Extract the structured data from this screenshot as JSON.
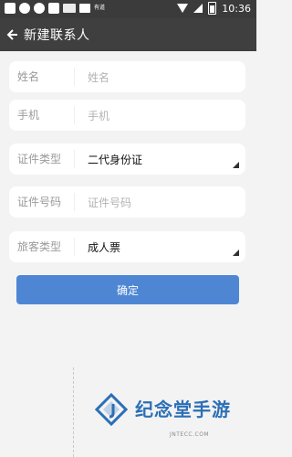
{
  "status_bar": {
    "time": "10:36",
    "left_icons": [
      "square-icon",
      "circle-icon",
      "circle-icon",
      "square-icon",
      "keyboard-icon",
      "image-icon",
      "text-icon"
    ],
    "text_icon_label": "有道"
  },
  "header": {
    "title": "新建联系人"
  },
  "form": {
    "rows": [
      {
        "label": "姓名",
        "value": "姓名",
        "type": "input"
      },
      {
        "label": "手机",
        "value": "手机",
        "type": "input"
      },
      {
        "label": "证件类型",
        "value": "二代身份证",
        "type": "select"
      },
      {
        "label": "证件号码",
        "value": "证件号码",
        "type": "input"
      },
      {
        "label": "旅客类型",
        "value": "成人票",
        "type": "select"
      }
    ]
  },
  "confirm_button": {
    "label": "确定"
  },
  "watermark": {
    "text": "纪念堂手游",
    "url": "JNTECC.COM"
  },
  "colors": {
    "header_bg": "#3f3f3f",
    "button": "#4e86d4",
    "background": "#f3f3f3",
    "watermark": "#2b6fb6"
  }
}
